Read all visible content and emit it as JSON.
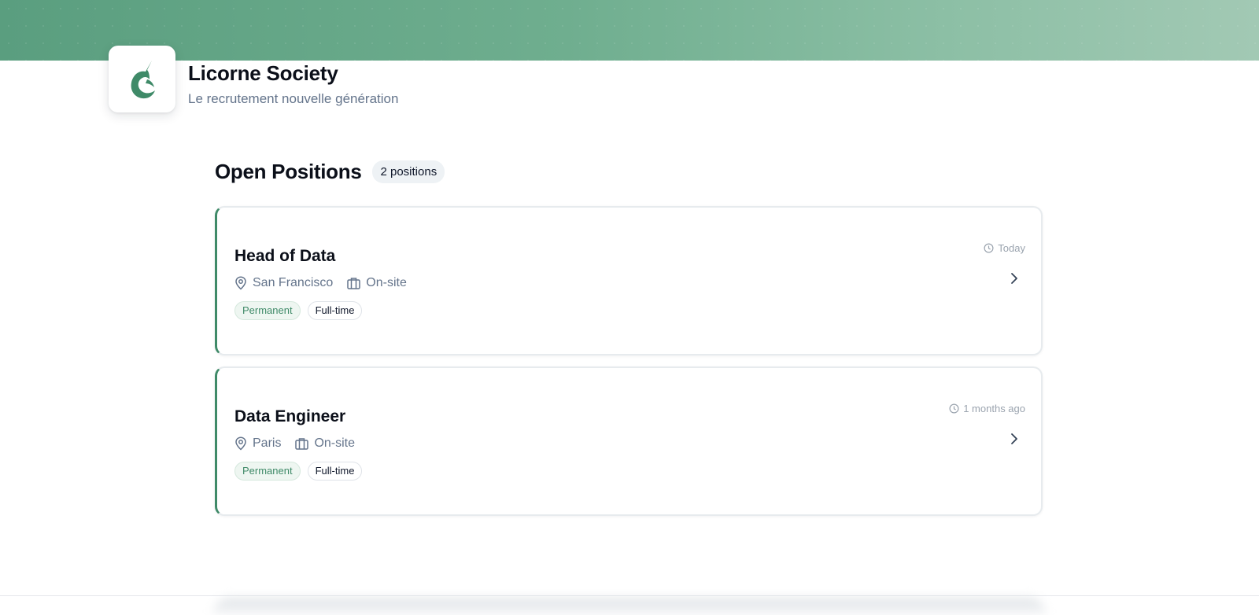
{
  "company": {
    "name": "Licorne Society",
    "tagline": "Le recrutement nouvelle génération",
    "logo_icon": "unicorn-icon",
    "brand_color": "#3f8a68"
  },
  "section": {
    "title": "Open Positions",
    "count_label": "2 positions"
  },
  "jobs": [
    {
      "title": "Head of Data",
      "location": "San Francisco",
      "workplace": "On-site",
      "tags": [
        "Permanent",
        "Full-time"
      ],
      "posted": "Today"
    },
    {
      "title": "Data Engineer",
      "location": "Paris",
      "workplace": "On-site",
      "tags": [
        "Permanent",
        "Full-time"
      ],
      "posted": "1 months ago"
    }
  ],
  "icons": {
    "location": "map-pin-icon",
    "workplace": "briefcase-icon",
    "posted": "clock-icon",
    "open": "chevron-right-icon"
  }
}
